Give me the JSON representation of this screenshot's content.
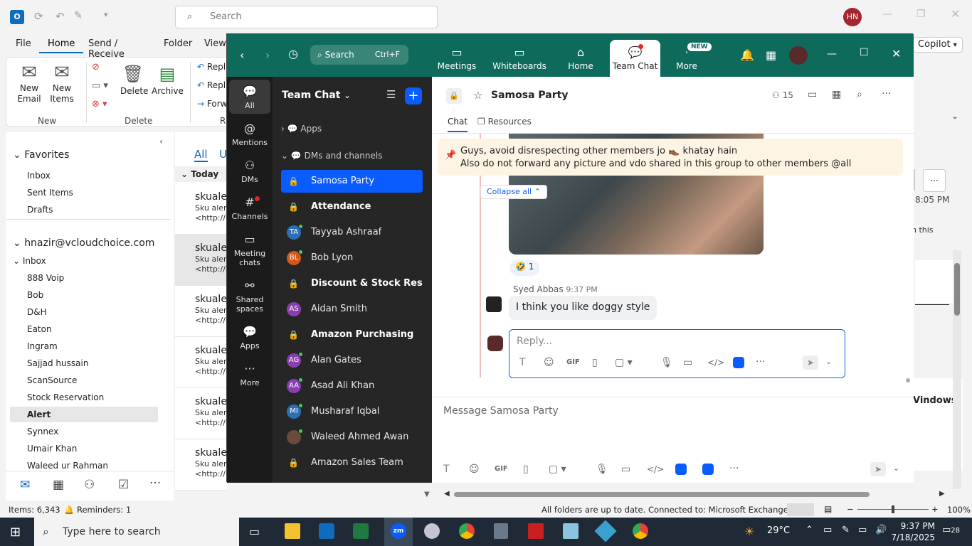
{
  "outlook": {
    "search_placeholder": "Search",
    "avatar_initials": "HN",
    "menu": [
      "File",
      "Home",
      "Send / Receive",
      "Folder",
      "View"
    ],
    "ribbon": {
      "new_email": "New\nEmail",
      "new_items": "New\nItems",
      "delete": "Delete",
      "archive": "Archive",
      "reply": "Repl",
      "reply_all": "Repl",
      "forward": "Forw",
      "group_new": "New",
      "group_delete": "Delete",
      "group_r": "R"
    },
    "favorites_label": "Favorites",
    "favorites": [
      "Inbox",
      "Sent Items",
      "Drafts"
    ],
    "account": "hnazir@vcloudchoice.com",
    "inbox_label": "Inbox",
    "folders": [
      "888 Voip",
      "Bob",
      "D&H",
      "Eaton",
      "Ingram",
      "Sajjad hussain",
      "ScanSource",
      "Stock Reservation",
      "Alert",
      "Synnex",
      "Umair Khan",
      "Waleed ur Rahman"
    ],
    "list_filter_all": "All",
    "list_filter_u": "U",
    "list_today": "Today",
    "mail_items": [
      {
        "sender": "skualer",
        "preview": "Sku alert",
        "url": "<http://i"
      },
      {
        "sender": "skualer",
        "preview": "Sku alert",
        "url": "<http://i"
      },
      {
        "sender": "skualer",
        "preview": "Sku alert",
        "url": "<http://i"
      },
      {
        "sender": "skualer",
        "preview": "Sku alert",
        "url": "<http://i"
      },
      {
        "sender": "skualer",
        "preview": "Sku alert",
        "url": "<http://i"
      },
      {
        "sender": "skualer",
        "preview": "Sku alert",
        "url": "<http://i"
      }
    ],
    "right_pane": {
      "copilot": "Copilot",
      "time": "8:05 PM",
      "snippet": "n this",
      "windows": "Vindows"
    },
    "status": {
      "items": "Items: 6,343",
      "reminders": "Reminders: 1",
      "sync": "All folders are up to date.",
      "connection": "Connected to: Microsoft Exchange",
      "zoom": "100%"
    }
  },
  "zoom": {
    "search": {
      "label": "Search",
      "shortcut": "Ctrl+F"
    },
    "tabs": [
      "Meetings",
      "Whiteboards",
      "Home",
      "Team Chat",
      "More"
    ],
    "new_badge": "NEW",
    "rail": [
      "All",
      "Mentions",
      "DMs",
      "Channels",
      "Meeting\nchats",
      "Shared\nspaces",
      "Apps",
      "More"
    ],
    "sidebar_title": "Team Chat",
    "apps_label": "Apps",
    "dms_label": "DMs and channels",
    "channels": [
      {
        "name": "Samosa Party",
        "type": "lock",
        "bold": false
      },
      {
        "name": "Attendance",
        "type": "lock",
        "bold": true
      },
      {
        "name": "Tayyab Ashraaf",
        "type": "av",
        "initials": "TA",
        "color": "#2c6fb5"
      },
      {
        "name": "Bob Lyon",
        "type": "av",
        "initials": "BL",
        "color": "#d4581a"
      },
      {
        "name": "Discount & Stock Res...",
        "type": "lock",
        "bold": true
      },
      {
        "name": "Aidan Smith",
        "type": "av",
        "initials": "AS",
        "color": "#8a3fb0"
      },
      {
        "name": "Amazon Purchasing",
        "type": "lock",
        "bold": true
      },
      {
        "name": "Alan Gates",
        "type": "av",
        "initials": "AG",
        "color": "#8a3fb0"
      },
      {
        "name": "Asad Ali Khan",
        "type": "av",
        "initials": "AA",
        "color": "#8a3fb0"
      },
      {
        "name": "Musharaf Iqbal",
        "type": "av",
        "initials": "MI",
        "color": "#2c6fb5"
      },
      {
        "name": "Waleed Ahmed Awan",
        "type": "photo",
        "initials": "",
        "color": "#6a4a3a"
      },
      {
        "name": "Amazon Sales Team",
        "type": "lock",
        "bold": false
      }
    ],
    "chat": {
      "title": "Samosa Party",
      "members": "15",
      "tabs": [
        "Chat",
        "Resources"
      ],
      "pinned_line1": "Guys, avoid disrespecting other members jo 👞 khatay hain",
      "pinned_line2": "Also do not forward any picture and vdo shared in this group to other members @all",
      "collapse": "Collapse all",
      "reaction": "🤣 1",
      "sender": "Syed Abbas",
      "sent_time": "9:37 PM",
      "message": "I think you like doggy style",
      "reply_placeholder": "Reply...",
      "compose_placeholder": "Message Samosa Party",
      "gif": "GIF"
    }
  },
  "taskbar": {
    "search": "Type here to search",
    "weather": "29°C",
    "time": "9:37 PM",
    "date": "7/18/2025",
    "notif": "28"
  }
}
